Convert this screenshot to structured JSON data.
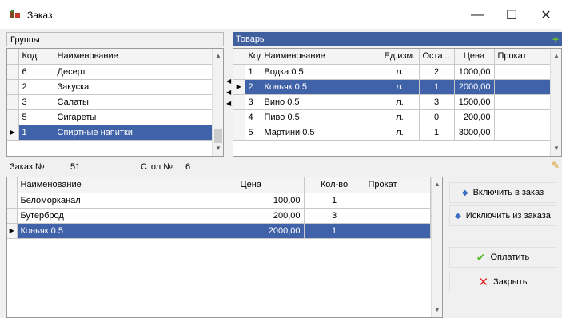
{
  "window": {
    "title": "Заказ",
    "minimize": "—",
    "maximize": "☐",
    "close": "✕"
  },
  "groups": {
    "caption": "Группы",
    "columns": [
      "Код",
      "Наименование"
    ],
    "rows": [
      [
        "6",
        "Десерт"
      ],
      [
        "2",
        "Закуска"
      ],
      [
        "3",
        "Салаты"
      ],
      [
        "5",
        "Сигареты"
      ],
      [
        "1",
        "Спиртные напитки"
      ]
    ],
    "selected_index": 4
  },
  "goods": {
    "caption": "Товары",
    "columns": [
      "Код",
      "Наименование",
      "Ед.изм.",
      "Оста...",
      "Цена",
      "Прокат"
    ],
    "rows": [
      [
        "1",
        "Водка 0.5",
        "л.",
        "2",
        "1000,00",
        ""
      ],
      [
        "2",
        "Коньяк 0.5",
        "л.",
        "1",
        "2000,00",
        ""
      ],
      [
        "3",
        "Вино 0.5",
        "л.",
        "3",
        "1500,00",
        ""
      ],
      [
        "4",
        "Пиво 0.5",
        "л.",
        "0",
        "200,00",
        ""
      ],
      [
        "5",
        "Мартини 0.5",
        "л.",
        "1",
        "3000,00",
        ""
      ]
    ],
    "selected_index": 1
  },
  "order_info": {
    "order_label": "Заказ №",
    "order_number": "51",
    "table_label": "Стол №",
    "table_number": "6"
  },
  "order": {
    "columns": [
      "Наименование",
      "Цена",
      "Кол-во",
      "Прокат"
    ],
    "rows": [
      [
        "Беломорканал",
        "100,00",
        "1",
        ""
      ],
      [
        "Бутерброд",
        "200,00",
        "3",
        ""
      ],
      [
        "Коньяк 0.5",
        "2000,00",
        "1",
        ""
      ]
    ],
    "selected_index": 2
  },
  "buttons": {
    "include": "Включить в заказ",
    "exclude": "Исключить из заказа",
    "pay": "Оплатить",
    "close": "Закрыть"
  },
  "colors": {
    "selection": "#3f62a8",
    "goods_header": "#3f5f9e",
    "add": "#6cbf2a",
    "pay": "#5cb82c",
    "close": "#e02020"
  }
}
